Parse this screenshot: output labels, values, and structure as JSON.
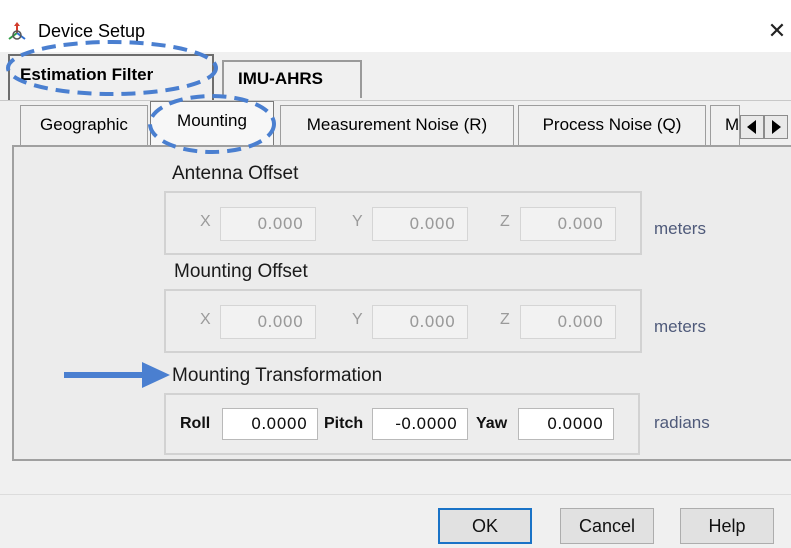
{
  "window": {
    "title": "Device Setup",
    "close_symbol": "✕"
  },
  "top_tabs": [
    {
      "label": "Estimation Filter",
      "active": true
    },
    {
      "label": "IMU-AHRS",
      "active": false
    }
  ],
  "sub_tabs": [
    {
      "label": "Geographic",
      "active": false
    },
    {
      "label": "Mounting",
      "active": true
    },
    {
      "label": "Measurement Noise (R)",
      "active": false
    },
    {
      "label": "Process Noise (Q)",
      "active": false
    },
    {
      "label": "M",
      "active": false
    }
  ],
  "antenna_offset": {
    "title": "Antenna Offset",
    "x_label": "X",
    "x_value": "0.000",
    "y_label": "Y",
    "y_value": "0.000",
    "z_label": "Z",
    "z_value": "0.000",
    "unit": "meters"
  },
  "mounting_offset": {
    "title": "Mounting Offset",
    "x_label": "X",
    "x_value": "0.000",
    "y_label": "Y",
    "y_value": "0.000",
    "z_label": "Z",
    "z_value": "0.000",
    "unit": "meters"
  },
  "mounting_transformation": {
    "title": "Mounting Transformation",
    "roll_label": "Roll",
    "roll_value": "0.0000",
    "pitch_label": "Pitch",
    "pitch_value": "-0.0000",
    "yaw_label": "Yaw",
    "yaw_value": "0.0000",
    "unit": "radians"
  },
  "footer": {
    "ok_label": "OK",
    "cancel_label": "Cancel",
    "help_label": "Help"
  },
  "colors": {
    "annotation_blue": "#4a7fd0",
    "default_button_border": "#1a73c7"
  }
}
